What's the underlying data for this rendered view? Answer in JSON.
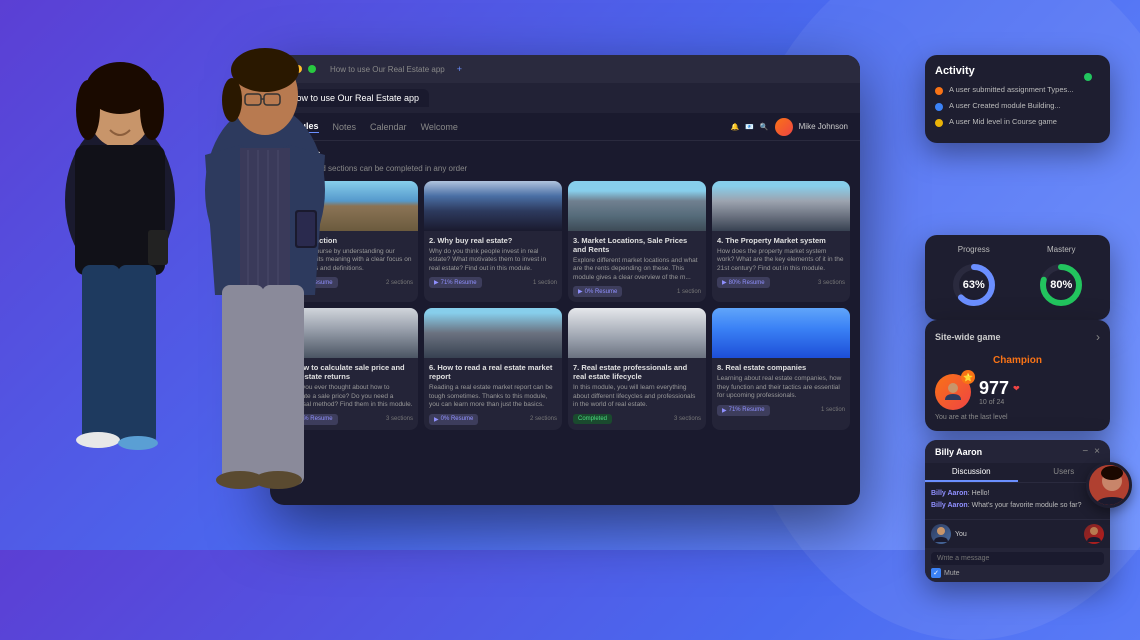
{
  "app": {
    "title": "How to use Our Real Estate app",
    "tab_label": "How to use Our Real Estate app",
    "nav": {
      "items": [
        "Modules",
        "Notes",
        "Calendar",
        "Welcome"
      ],
      "active": "Modules"
    },
    "user": {
      "name": "Mike Johnson"
    }
  },
  "modules_page": {
    "title": "Modules",
    "subtitle": "Modules and sections can be completed in any order",
    "cards": [
      {
        "number": "1",
        "title": "1. Introduction",
        "desc": "Start this course by understanding our estate and its meaning with a clear focus on basic terms and definitions.",
        "progress": 71,
        "progress_label": "71% Resume",
        "sections": "2 sections",
        "image_class": "img-building1"
      },
      {
        "number": "2",
        "title": "2. Why buy real estate?",
        "desc": "Why do you think people invest in real estate? What motivates them to invest in real estate? Find out in this module.",
        "progress": 71,
        "progress_label": "71% Resume",
        "sections": "1 section",
        "image_class": "img-building2"
      },
      {
        "number": "3",
        "title": "3. Market Locations, Sale Prices and Rents",
        "desc": "Explore different market locations and what are the rents depending on these. This module gives a clear overview of the m...",
        "progress": 0,
        "progress_label": "0% Resume",
        "sections": "1 section",
        "image_class": "img-building3"
      },
      {
        "number": "4",
        "title": "4. The Property Market system",
        "desc": "How does the property market system work? What are the key elements of it in the 21st century? Find out in this module.",
        "progress": 80,
        "progress_label": "80% Resume",
        "sections": "3 sections",
        "image_class": "img-building4"
      },
      {
        "number": "5",
        "title": "5. How to calculate sale price and real estate returns",
        "desc": "Have you ever thought about how to calculate a sale price? Do you need a universal method? Find them in this module.",
        "progress": 71,
        "progress_label": "71% Resume",
        "sections": "3 sections",
        "image_class": "img-building5"
      },
      {
        "number": "6",
        "title": "6. How to read a real estate market report",
        "desc": "Reading a real estate market report can be tough sometimes. Thanks to this module, you can learn more than just the basics.",
        "progress": 0,
        "progress_label": "0% Resume",
        "sections": "2 sections",
        "image_class": "img-building6"
      },
      {
        "number": "7",
        "title": "7. Real estate professionals and real estate lifecycle",
        "desc": "In this module, you will learn everything about different lifecycles and professionals in the world of real estate.",
        "progress": 100,
        "progress_label": "Completed",
        "sections": "3 sections",
        "image_class": "img-building7"
      },
      {
        "number": "8",
        "title": "8. Real estate companies",
        "desc": "Learning about real estate companies, how they function and their tactics are essential for upcoming professionals.",
        "progress": 71,
        "progress_label": "71% Resume",
        "sections": "1 section",
        "image_class": "img-building8"
      }
    ]
  },
  "activity": {
    "title": "Activity",
    "items": [
      {
        "color": "orange",
        "text": "A user submitted assignment Types..."
      },
      {
        "color": "blue",
        "text": "A user Created module Building..."
      },
      {
        "color": "yellow",
        "text": "A user Mid level in Course game"
      }
    ]
  },
  "progress": {
    "title": "Progress",
    "value": 63,
    "label": "63%",
    "color": "#6b8fff"
  },
  "mastery": {
    "title": "Mastery",
    "value": 80,
    "label": "80%",
    "color": "#22c55e"
  },
  "game": {
    "title": "Site-wide game",
    "rank": "Champion",
    "score": "977",
    "level_text": "10 of 24",
    "sub_text": "You are at the last level"
  },
  "chat": {
    "title": "Billy Aaron",
    "tabs": [
      "Discussion",
      "Users"
    ],
    "active_tab": "Discussion",
    "messages": [
      {
        "sender": "Billy Aaron",
        "text": "Hello!"
      },
      {
        "sender": "Billy Aaron",
        "text": "What's your favorite module so far?"
      }
    ],
    "input_placeholder": "Write a message",
    "users_label": "You",
    "user_name": "Billy Aaron",
    "mute_label": "Mute"
  }
}
